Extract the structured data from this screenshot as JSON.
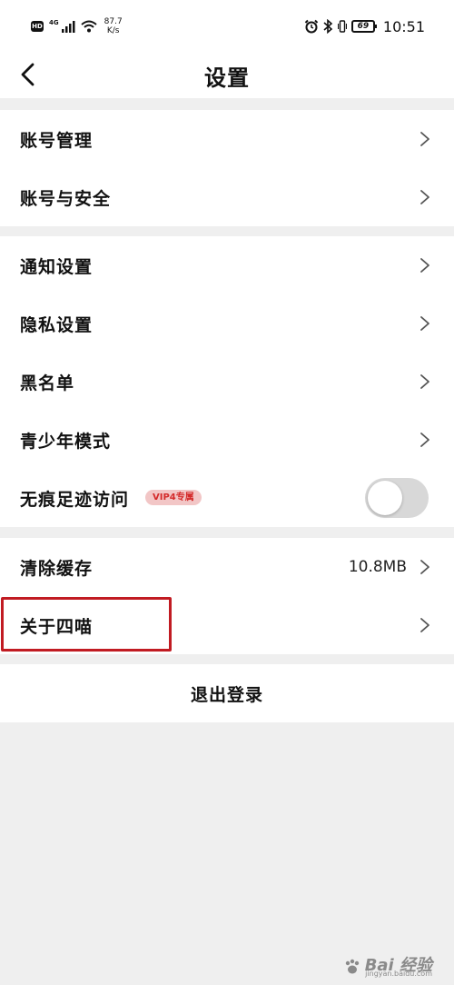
{
  "status_bar": {
    "hd": "HD",
    "signal_label": "4G",
    "speed_value": "87.7",
    "speed_unit": "K/s",
    "battery": "69",
    "time": "10:51"
  },
  "nav": {
    "title": "设置"
  },
  "groups": [
    {
      "items": [
        {
          "label": "账号管理"
        },
        {
          "label": "账号与安全"
        }
      ]
    },
    {
      "items": [
        {
          "label": "通知设置"
        },
        {
          "label": "隐私设置"
        },
        {
          "label": "黑名单"
        },
        {
          "label": "青少年模式"
        },
        {
          "label": "无痕足迹访问",
          "badge": "VIP4专属",
          "toggle_on": false
        }
      ]
    },
    {
      "items": [
        {
          "label": "清除缓存",
          "value": "10.8MB"
        },
        {
          "label": "关于四喵"
        }
      ]
    }
  ],
  "logout_label": "退出登录",
  "watermark": {
    "main": "Bai 经验",
    "sub": "jingyan.baidu.com"
  },
  "colors": {
    "background": "#efefef",
    "card": "#ffffff",
    "highlight": "#c11b22",
    "vip_badge_text": "#d42b2b",
    "vip_badge_bg": "#f2c6c6"
  }
}
